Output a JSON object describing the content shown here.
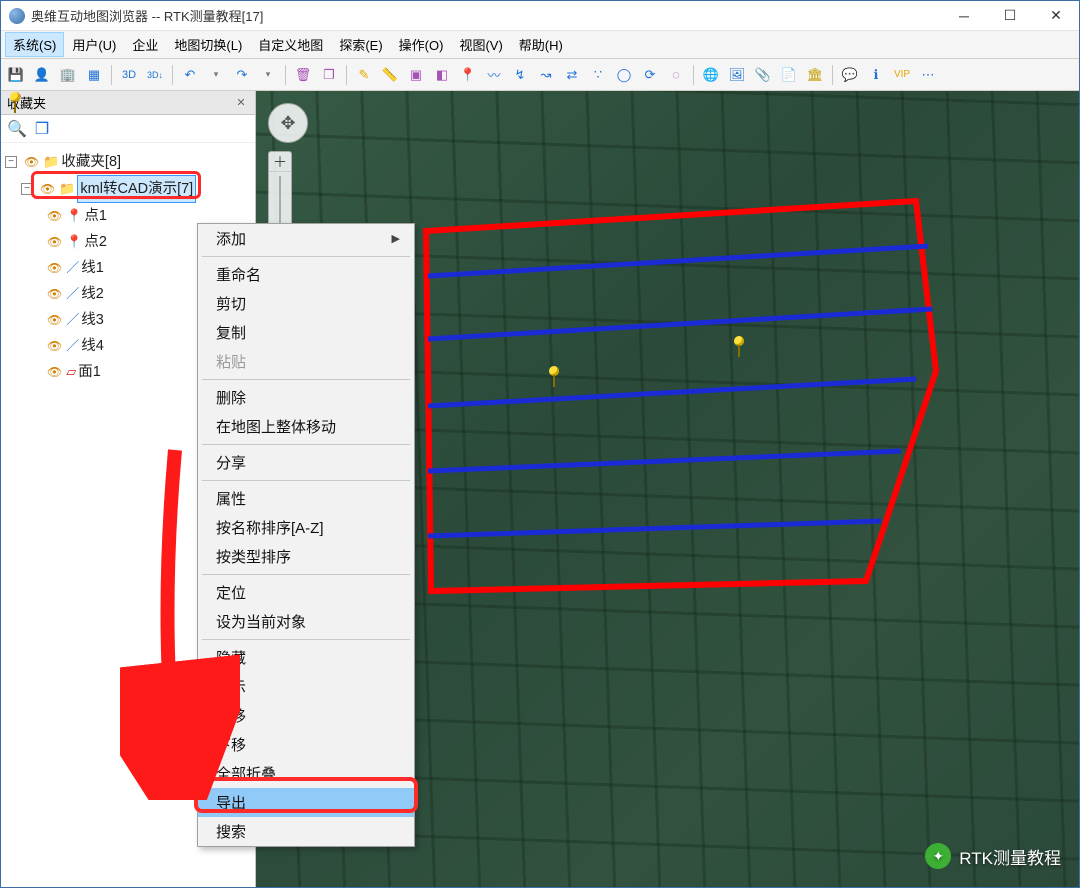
{
  "window": {
    "title": "奥维互动地图浏览器 -- RTK测量教程[17]"
  },
  "menubar": {
    "items": [
      "系统(S)",
      "用户(U)",
      "企业",
      "地图切换(L)",
      "自定义地图",
      "探索(E)",
      "操作(O)",
      "视图(V)",
      "帮助(H)"
    ],
    "active_index": 0
  },
  "toolbar": {
    "icons": [
      {
        "name": "save-icon",
        "glyph": "💾",
        "color": "#1e73d6"
      },
      {
        "name": "user-icon",
        "glyph": "👤",
        "color": "#1e73d6"
      },
      {
        "name": "org-icon",
        "glyph": "🏢",
        "color": "#1e73d6"
      },
      {
        "name": "grid-icon",
        "glyph": "▦",
        "color": "#1e73d6"
      },
      {
        "name": "sep"
      },
      {
        "name": "3d-icon",
        "glyph": "3D",
        "color": "#1e73d6",
        "fs": "11px"
      },
      {
        "name": "3d2d-icon",
        "glyph": "3D↓",
        "color": "#1e73d6",
        "fs": "9px"
      },
      {
        "name": "sep"
      },
      {
        "name": "undo-icon",
        "glyph": "↶",
        "color": "#1e73d6"
      },
      {
        "name": "undo-dd-icon",
        "glyph": "▾",
        "color": "#777",
        "fs": "9px"
      },
      {
        "name": "redo-icon",
        "glyph": "↷",
        "color": "#1e73d6"
      },
      {
        "name": "redo-dd-icon",
        "glyph": "▾",
        "color": "#777",
        "fs": "9px"
      },
      {
        "name": "sep"
      },
      {
        "name": "delete-icon",
        "glyph": "🗑",
        "color": "#a551b5"
      },
      {
        "name": "layers-icon",
        "glyph": "❐",
        "color": "#a551b5"
      },
      {
        "name": "sep"
      },
      {
        "name": "track-icon",
        "glyph": "✎",
        "color": "#e5a800"
      },
      {
        "name": "ruler-icon",
        "glyph": "📏",
        "color": "#a551b5"
      },
      {
        "name": "area-icon",
        "glyph": "▣",
        "color": "#a551b5"
      },
      {
        "name": "shape-icon",
        "glyph": "◧",
        "color": "#a551b5"
      },
      {
        "name": "pin-icon",
        "glyph": "📍",
        "color": "#e5a800"
      },
      {
        "name": "polyline-icon",
        "glyph": "〰",
        "color": "#1e73d6"
      },
      {
        "name": "route-icon",
        "glyph": "↯",
        "color": "#1e73d6"
      },
      {
        "name": "path-icon",
        "glyph": "↝",
        "color": "#1e73d6"
      },
      {
        "name": "dist-icon",
        "glyph": "⇄",
        "color": "#1e73d6"
      },
      {
        "name": "points-icon",
        "glyph": "∵",
        "color": "#1e73d6"
      },
      {
        "name": "circle-icon",
        "glyph": "◯",
        "color": "#1e73d6"
      },
      {
        "name": "refresh-icon",
        "glyph": "⟳",
        "color": "#1e73d6"
      },
      {
        "name": "dring-icon",
        "glyph": "◌",
        "color": "#a551b5"
      },
      {
        "name": "sep"
      },
      {
        "name": "globe-icon",
        "glyph": "🌐",
        "color": "#1e73d6"
      },
      {
        "name": "image-icon",
        "glyph": "🖼",
        "color": "#1e73d6"
      },
      {
        "name": "attach-icon",
        "glyph": "📎",
        "color": "#1e73d6"
      },
      {
        "name": "doc-icon",
        "glyph": "📄",
        "color": "#1e73d6"
      },
      {
        "name": "building-icon",
        "glyph": "🏛",
        "color": "#c59a00"
      },
      {
        "name": "sep"
      },
      {
        "name": "chat-icon",
        "glyph": "💬",
        "color": "#26a65b"
      },
      {
        "name": "info-icon",
        "glyph": "ℹ",
        "color": "#1e73d6"
      },
      {
        "name": "vip-icon",
        "glyph": "VIP",
        "color": "#e5a800",
        "fs": "10px"
      },
      {
        "name": "more-icon",
        "glyph": "⋯",
        "color": "#1e73d6"
      }
    ]
  },
  "sidebar": {
    "title": "收藏夹",
    "root": "收藏夹[8]",
    "folder": "kml转CAD演示[7]",
    "children": [
      {
        "label": "点1",
        "type": "pin"
      },
      {
        "label": "点2",
        "type": "pin"
      },
      {
        "label": "线1",
        "type": "line"
      },
      {
        "label": "线2",
        "type": "line"
      },
      {
        "label": "线3",
        "type": "line"
      },
      {
        "label": "线4",
        "type": "line"
      },
      {
        "label": "面1",
        "type": "poly"
      }
    ]
  },
  "contextmenu": {
    "highlighted": "导出",
    "groups": [
      [
        {
          "label": "添加",
          "submenu": true
        }
      ],
      [
        {
          "label": "重命名"
        },
        {
          "label": "剪切"
        },
        {
          "label": "复制"
        },
        {
          "label": "粘贴",
          "disabled": true
        }
      ],
      [
        {
          "label": "删除"
        },
        {
          "label": "在地图上整体移动"
        }
      ],
      [
        {
          "label": "分享"
        }
      ],
      [
        {
          "label": "属性"
        },
        {
          "label": "按名称排序[A-Z]"
        },
        {
          "label": "按类型排序"
        }
      ],
      [
        {
          "label": "定位"
        },
        {
          "label": "设为当前对象"
        }
      ],
      [
        {
          "label": "隐藏"
        },
        {
          "label": "显示"
        },
        {
          "label": "上移"
        },
        {
          "label": "下移"
        },
        {
          "label": "全部折叠"
        },
        {
          "label": "导出"
        },
        {
          "label": "搜索"
        }
      ]
    ]
  },
  "watermark": {
    "text": "RTK测量教程",
    "icon_label": "微信"
  }
}
